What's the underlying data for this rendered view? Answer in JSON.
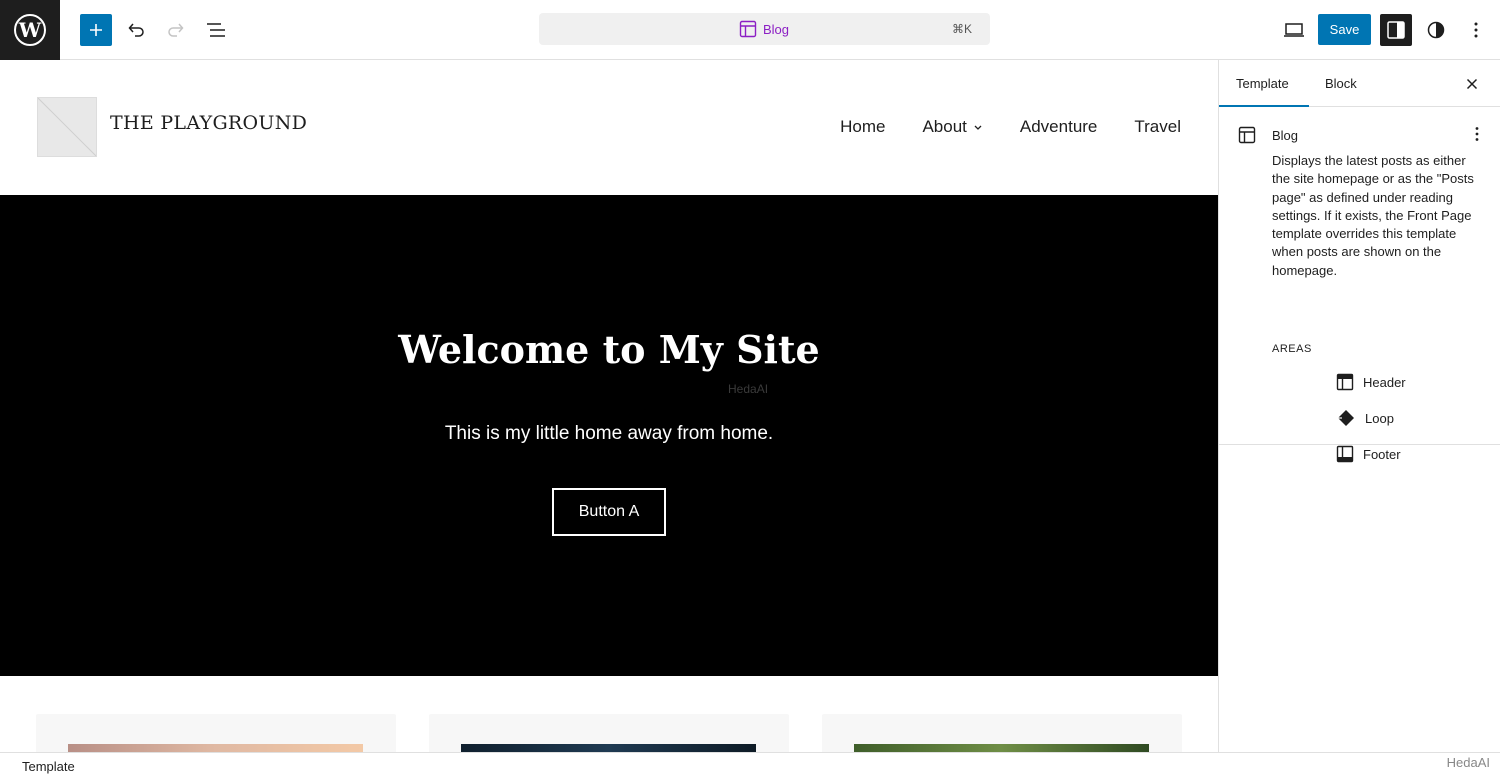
{
  "toolbar": {
    "document_title": "Blog",
    "shortcut": "⌘K",
    "save_label": "Save"
  },
  "site": {
    "title": "THE PLAYGROUND",
    "nav": [
      "Home",
      "About",
      "Adventure",
      "Travel"
    ]
  },
  "hero": {
    "title": "Welcome to My Site",
    "subtitle": "This is my little home away from home.",
    "button": "Button A",
    "watermark": "HedaAI"
  },
  "sidebar": {
    "tabs": [
      "Template",
      "Block"
    ],
    "template_name": "Blog",
    "description": "Displays the latest posts as either the site homepage or as the \"Posts page\" as defined under reading settings. If it exists, the Front Page template overrides this template when posts are shown on the homepage.",
    "areas_label": "AREAS",
    "areas": [
      "Header",
      "Loop",
      "Footer"
    ]
  },
  "footer": {
    "breadcrumb": "Template",
    "watermark": "HedaAI"
  },
  "colors": {
    "accent": "#0075b3",
    "template_purple": "#8c1fc4"
  }
}
